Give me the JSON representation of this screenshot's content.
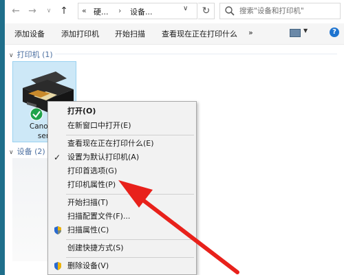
{
  "address_bar": {
    "back_icon": "left-arrow-icon",
    "forward_icon": "right-arrow-icon",
    "recent_icon": "chevron-down-icon",
    "up_icon": "up-arrow-icon",
    "prefix": "«",
    "crumb_1": "硬...",
    "separator": "›",
    "crumb_2": "设备...",
    "dropdown_icon": "chevron-down-icon",
    "refresh_icon": "refresh-icon",
    "search_placeholder": "搜索\"设备和打印机\""
  },
  "toolbar": {
    "items": [
      "添加设备",
      "添加打印机",
      "开始扫描",
      "查看现在正在打印什么",
      "»"
    ],
    "view_icon": "view-options-icon",
    "help_icon": "help-icon",
    "help_label": "?"
  },
  "groups": {
    "printers": "打印机 (1)",
    "devices": "设备 (2)"
  },
  "printer": {
    "name_line1": "Canon T",
    "name_line2": "seri",
    "status_icon": "green-check-icon"
  },
  "context_menu": {
    "items": [
      {
        "label": "打开(O)",
        "bold": true
      },
      {
        "label": "在新窗口中打开(E)"
      },
      {
        "label": "查看现在正在打印什么(E)"
      },
      {
        "label": "设置为默认打印机(A)",
        "checked": true
      },
      {
        "label": "打印首选项(G)"
      },
      {
        "label": "打印机属性(P)"
      },
      {
        "label": "开始扫描(T)"
      },
      {
        "label": "扫描配置文件(F)..."
      },
      {
        "label": "扫描属性(C)",
        "shield": true
      },
      {
        "label": "创建快捷方式(S)"
      },
      {
        "label": "删除设备(V)",
        "shield": true
      }
    ]
  },
  "colors": {
    "accent_arrow": "#e8211b",
    "selection": "#cde8f7",
    "group_header": "#4a6ea0"
  }
}
